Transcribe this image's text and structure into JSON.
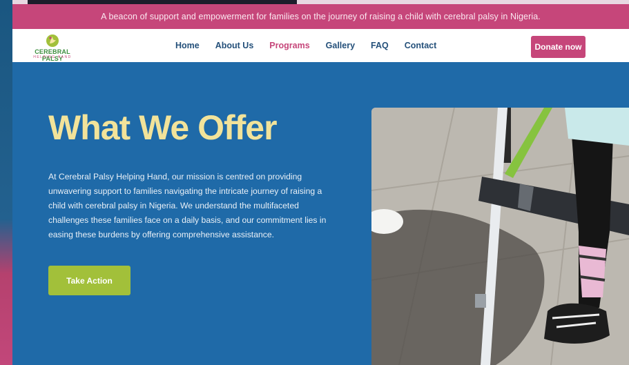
{
  "announcement": "A beacon of support and empowerment for families on the journey of raising a child with cerebral palsy in Nigeria.",
  "logo": {
    "name": "CEREBRAL PALSY",
    "tagline": "HELPING HAND"
  },
  "nav": {
    "items": [
      {
        "label": "Home"
      },
      {
        "label": "About Us"
      },
      {
        "label": "Programs"
      },
      {
        "label": "Gallery"
      },
      {
        "label": "FAQ"
      },
      {
        "label": "Contact"
      }
    ],
    "active": "Programs"
  },
  "donate_label": "Donate now",
  "hero": {
    "title": "What We Offer",
    "body": "At Cerebral Palsy Helping Hand, our mission is centred on providing unwavering support to families navigating the intricate journey of raising a child with cerebral palsy in Nigeria. We understand the multifaceted challenges these families face on a daily basis, and our commitment lies in easing these burdens by offering comprehensive assistance.",
    "cta_label": "Take Action"
  },
  "colors": {
    "pink": "#c6467a",
    "blue": "#1f6aa8",
    "title_yellow": "#f2e39a",
    "cta_green": "#a2c03a"
  }
}
